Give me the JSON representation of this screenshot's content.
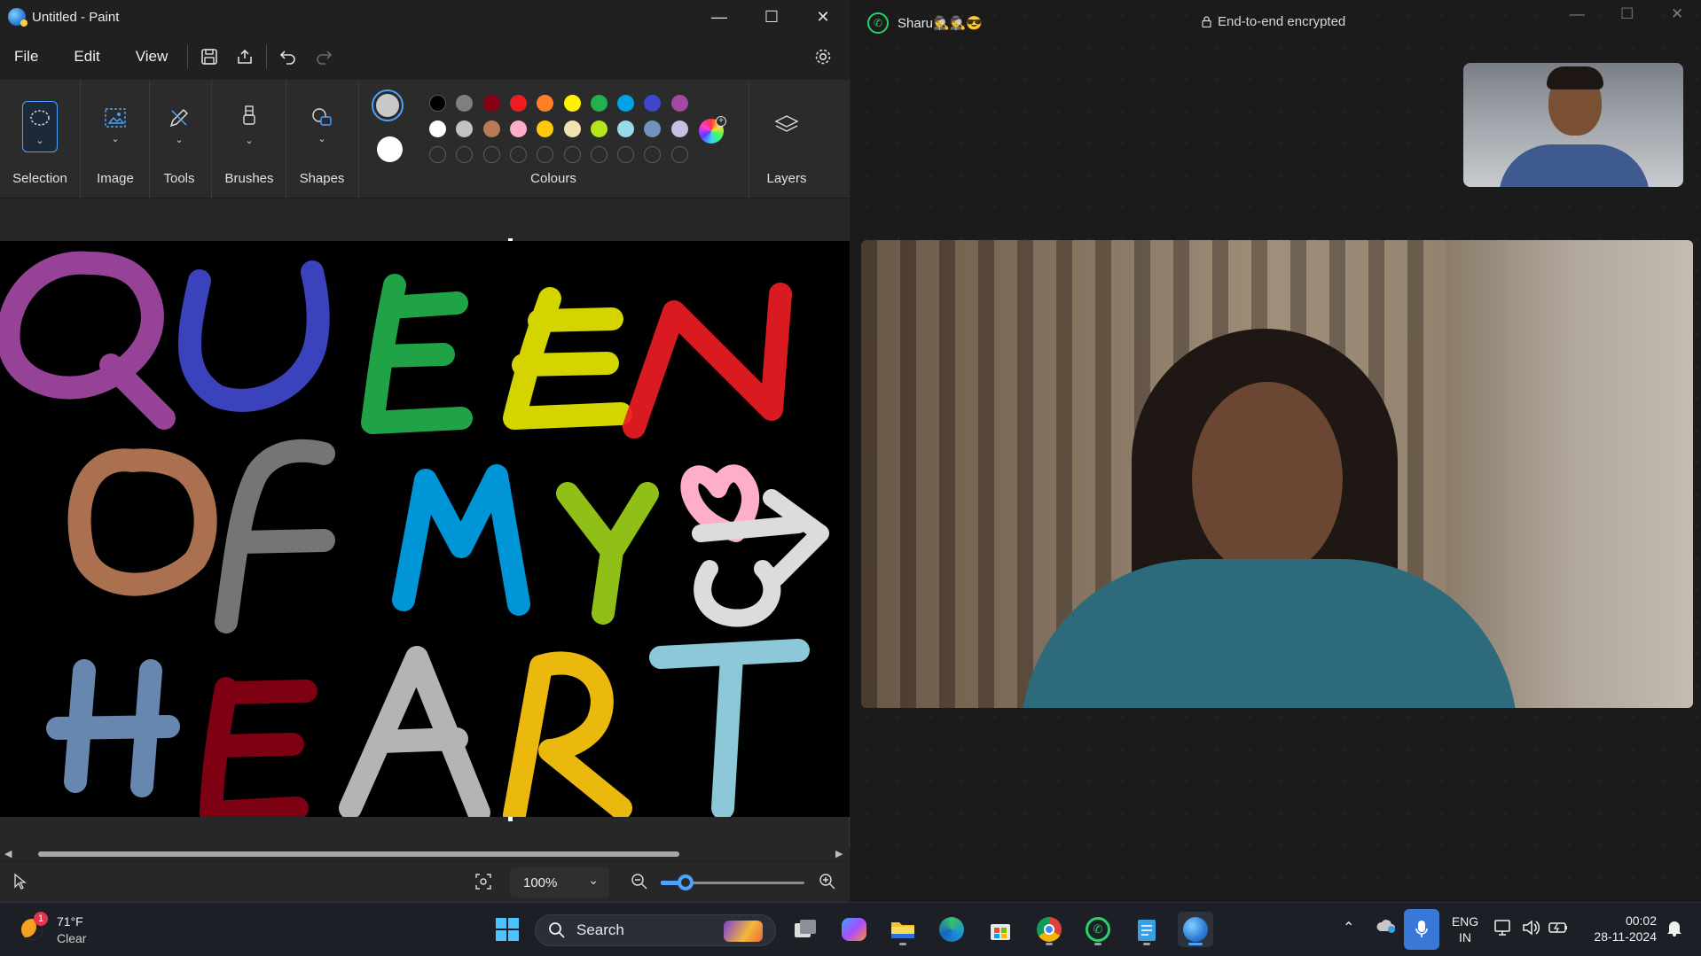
{
  "paint": {
    "title": "Untitled - Paint",
    "menu": {
      "file": "File",
      "edit": "Edit",
      "view": "View"
    },
    "ribbon": {
      "selection": "Selection",
      "image": "Image",
      "tools": "Tools",
      "brushes": "Brushes",
      "shapes": "Shapes",
      "colours": "Colours",
      "layers": "Layers"
    },
    "palette": {
      "primary": "#c8c8c8",
      "secondary": "#ffffff",
      "row1": [
        "#000000",
        "#7f7f7f",
        "#880015",
        "#ed1c24",
        "#ff7f27",
        "#fff200",
        "#22b14c",
        "#00a2e8",
        "#3f48cc",
        "#a349a4"
      ],
      "row2": [
        "#ffffff",
        "#c3c3c3",
        "#b97a57",
        "#ffaec9",
        "#ffc90e",
        "#efe4b0",
        "#b5e61d",
        "#99d9ea",
        "#7092be",
        "#c8bfe7"
      ]
    },
    "canvas": {
      "line1": [
        {
          "ch": "Q",
          "color": "#a349a4"
        },
        {
          "ch": "U",
          "color": "#3f48cc"
        },
        {
          "ch": "E",
          "color": "#22b14c"
        },
        {
          "ch": "E",
          "color": "#e6e600"
        },
        {
          "ch": "N",
          "color": "#ed1c24"
        }
      ],
      "line2": [
        {
          "ch": "O",
          "color": "#b97a57"
        },
        {
          "ch": "F",
          "color": "#7f7f7f"
        },
        {
          "ch": "M",
          "color": "#00a2e8"
        },
        {
          "ch": "Y",
          "color": "#9ccf1a"
        }
      ],
      "line3": [
        {
          "ch": "H",
          "color": "#7092be"
        },
        {
          "ch": "E",
          "color": "#880015"
        },
        {
          "ch": "A",
          "color": "#c3c3c3"
        },
        {
          "ch": "R",
          "color": "#ffc90e"
        },
        {
          "ch": "T",
          "color": "#99d9ea"
        }
      ],
      "heart_color": "#ffaec9",
      "arrow_color": "#dcdcdc"
    },
    "zoom": "100%"
  },
  "whatsapp": {
    "contact": "Sharu🕵️🕵️😎",
    "encryption": "End-to-end encrypted"
  },
  "taskbar": {
    "weather_temp": "71°F",
    "weather_desc": "Clear",
    "weather_badge": "1",
    "search_label": "Search",
    "lang_line1": "ENG",
    "lang_line2": "IN",
    "time": "00:02",
    "date": "28-11-2024"
  }
}
